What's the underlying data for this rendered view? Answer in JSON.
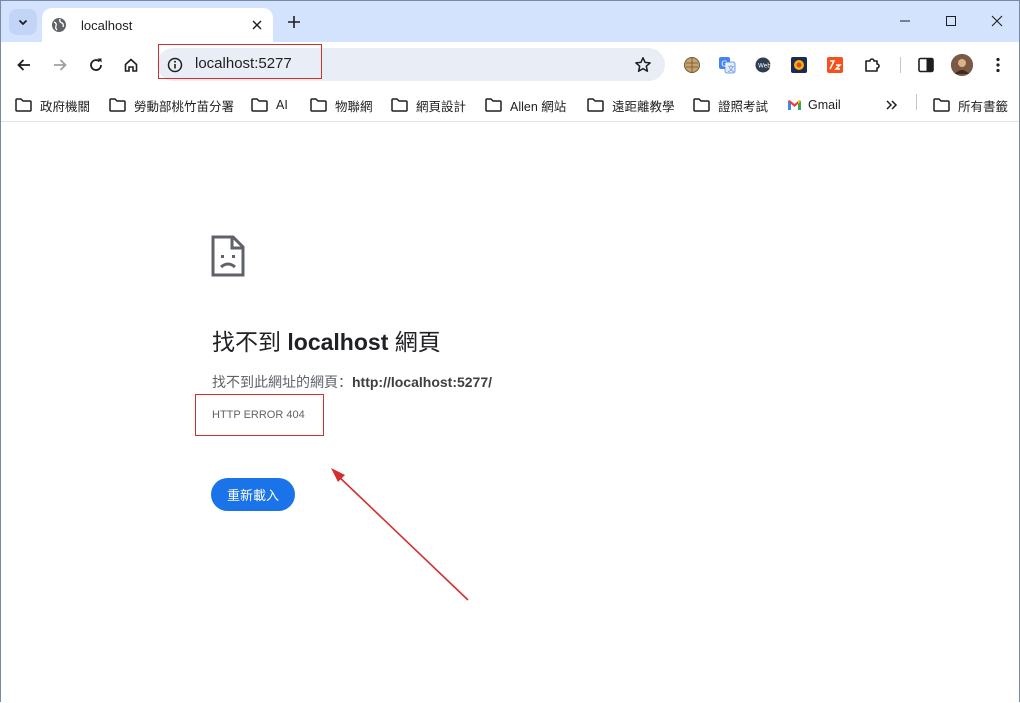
{
  "tab": {
    "title": "localhost"
  },
  "omnibox": {
    "url": "localhost:5277"
  },
  "bookmarks": [
    {
      "label": "政府機關"
    },
    {
      "label": "勞動部桃竹苗分署"
    },
    {
      "label": "AI"
    },
    {
      "label": "物聯網"
    },
    {
      "label": "網頁設計"
    },
    {
      "label": "Allen 網站"
    },
    {
      "label": "遠距離教學"
    },
    {
      "label": "證照考試"
    },
    {
      "label": "Gmail"
    }
  ],
  "bookmarks_more": {
    "label": "所有書籤"
  },
  "error": {
    "title_prefix": "找不到",
    "title_host": "localhost",
    "title_suffix": "網頁",
    "desc_prefix": "找不到此網址的網頁：",
    "desc_url": "http://localhost:5277/",
    "code": "HTTP ERROR 404",
    "reload_label": "重新載入"
  },
  "colors": {
    "tabstrip": "#d3e3fd",
    "omnibox": "#e9eef6",
    "reload_button": "#1a73e8",
    "annotation": "#d32f2f"
  }
}
